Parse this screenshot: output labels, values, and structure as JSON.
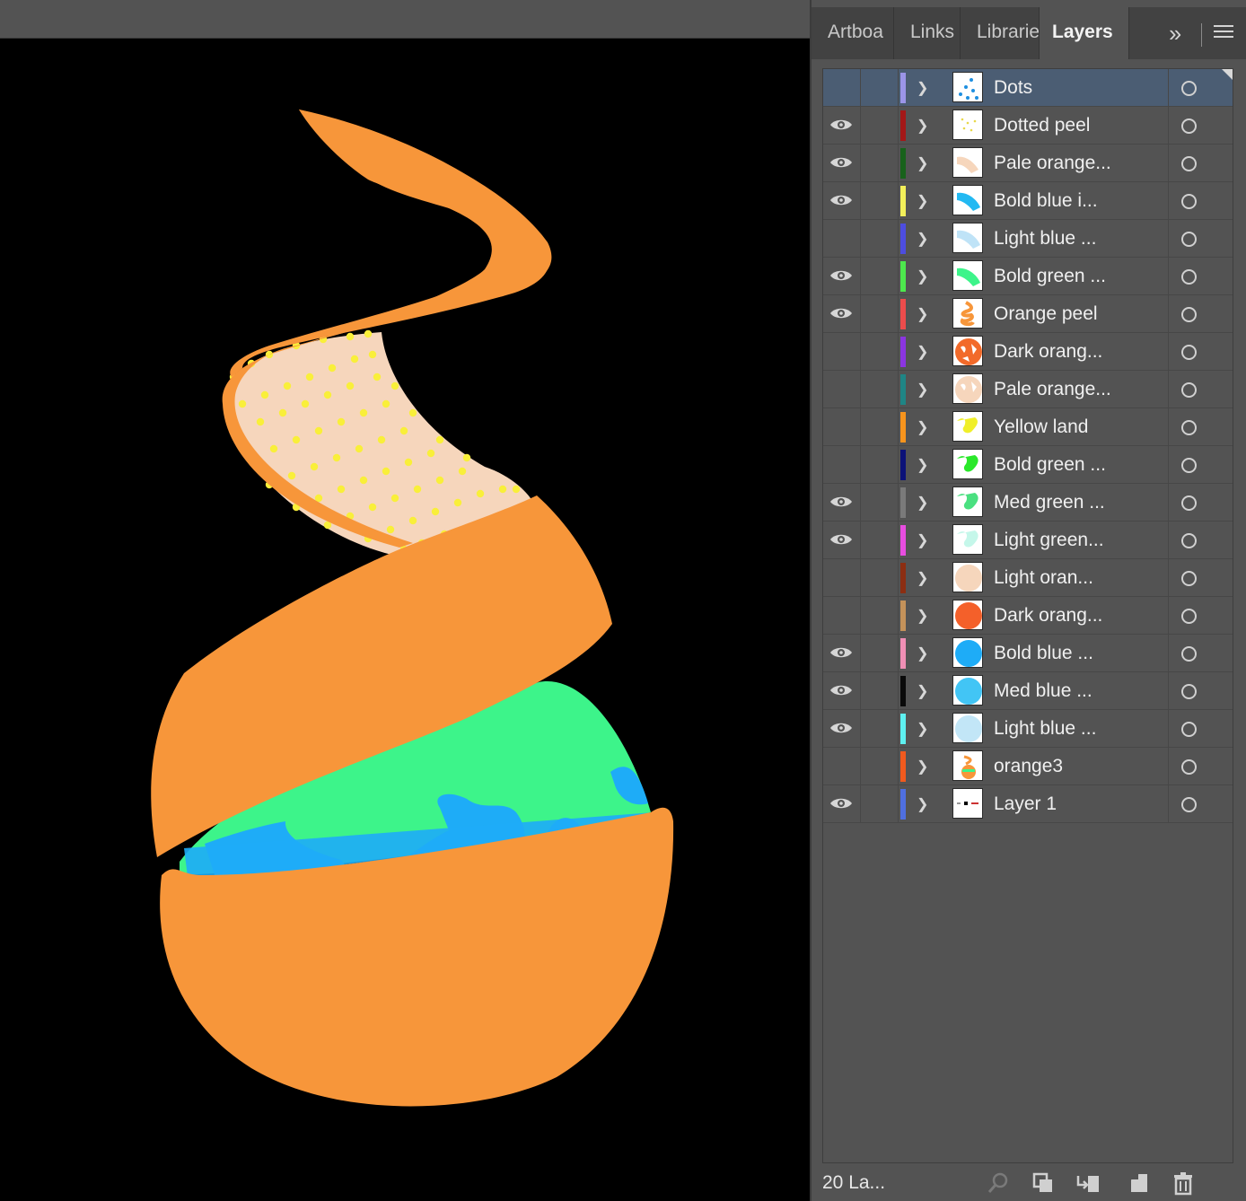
{
  "panel": {
    "tabs": [
      {
        "label": "Artboa",
        "active": false
      },
      {
        "label": "Links",
        "active": false
      },
      {
        "label": "Librarie",
        "active": false
      },
      {
        "label": "Layers",
        "active": true
      }
    ],
    "more_icon": "double-chevron-right-icon",
    "menu_icon": "hamburger-menu-icon"
  },
  "layers": [
    {
      "name": "Dots",
      "visible": false,
      "color": "#9b95e8",
      "selected": true,
      "thumb": "dots"
    },
    {
      "name": "Dotted peel",
      "visible": true,
      "color": "#a31818",
      "thumb": "dotted-peel"
    },
    {
      "name": "Pale orange...",
      "visible": true,
      "color": "#18621b",
      "thumb": "pale-orange-peel"
    },
    {
      "name": "Bold blue i...",
      "visible": true,
      "color": "#f2ef5a",
      "thumb": "bold-blue-peel"
    },
    {
      "name": "Light blue ...",
      "visible": false,
      "color": "#4d4ddf",
      "thumb": "light-blue-peel"
    },
    {
      "name": "Bold green ...",
      "visible": true,
      "color": "#4de84d",
      "thumb": "bold-green-peel"
    },
    {
      "name": "Orange peel",
      "visible": true,
      "color": "#ec4c4c",
      "thumb": "orange-peel"
    },
    {
      "name": "Dark orang...",
      "visible": false,
      "color": "#8b35e0",
      "thumb": "dark-orange-land"
    },
    {
      "name": "Pale orange...",
      "visible": false,
      "color": "#1f8585",
      "thumb": "pale-orange-land"
    },
    {
      "name": "Yellow land",
      "visible": false,
      "color": "#f7941d",
      "thumb": "yellow-land"
    },
    {
      "name": "Bold green ...",
      "visible": false,
      "color": "#0c1278",
      "thumb": "bold-green-land"
    },
    {
      "name": "Med green ...",
      "visible": true,
      "color": "#7a7a7a",
      "thumb": "med-green-land"
    },
    {
      "name": "Light green...",
      "visible": true,
      "color": "#e84de0",
      "thumb": "light-green-land"
    },
    {
      "name": "Light oran...",
      "visible": false,
      "color": "#8c2e12",
      "thumb": "light-orange-circle"
    },
    {
      "name": "Dark orang...",
      "visible": false,
      "color": "#c4925a",
      "thumb": "dark-orange-circle"
    },
    {
      "name": "Bold blue ...",
      "visible": true,
      "color": "#f08fb5",
      "thumb": "bold-blue-circle"
    },
    {
      "name": "Med blue ...",
      "visible": true,
      "color": "#0a0a0a",
      "thumb": "med-blue-circle"
    },
    {
      "name": "Light blue ...",
      "visible": true,
      "color": "#5ef0f0",
      "thumb": "light-blue-circle"
    },
    {
      "name": "orange3",
      "visible": false,
      "color": "#f05a1e",
      "thumb": "orange3"
    },
    {
      "name": "Layer 1",
      "visible": true,
      "color": "#4f6fe0",
      "thumb": "layer1"
    }
  ],
  "footer": {
    "count_label": "20 La...",
    "icons": [
      "search-layer-icon",
      "clipping-mask-icon",
      "sublayer-icon",
      "new-layer-icon",
      "trash-icon"
    ]
  },
  "artwork": {
    "colors": {
      "peel": "#f7963a",
      "pale": "#f6d6bc",
      "dot": "#f9ef3a",
      "green": "#3df48a",
      "blue": "#1eacf7",
      "background": "#000000"
    }
  }
}
